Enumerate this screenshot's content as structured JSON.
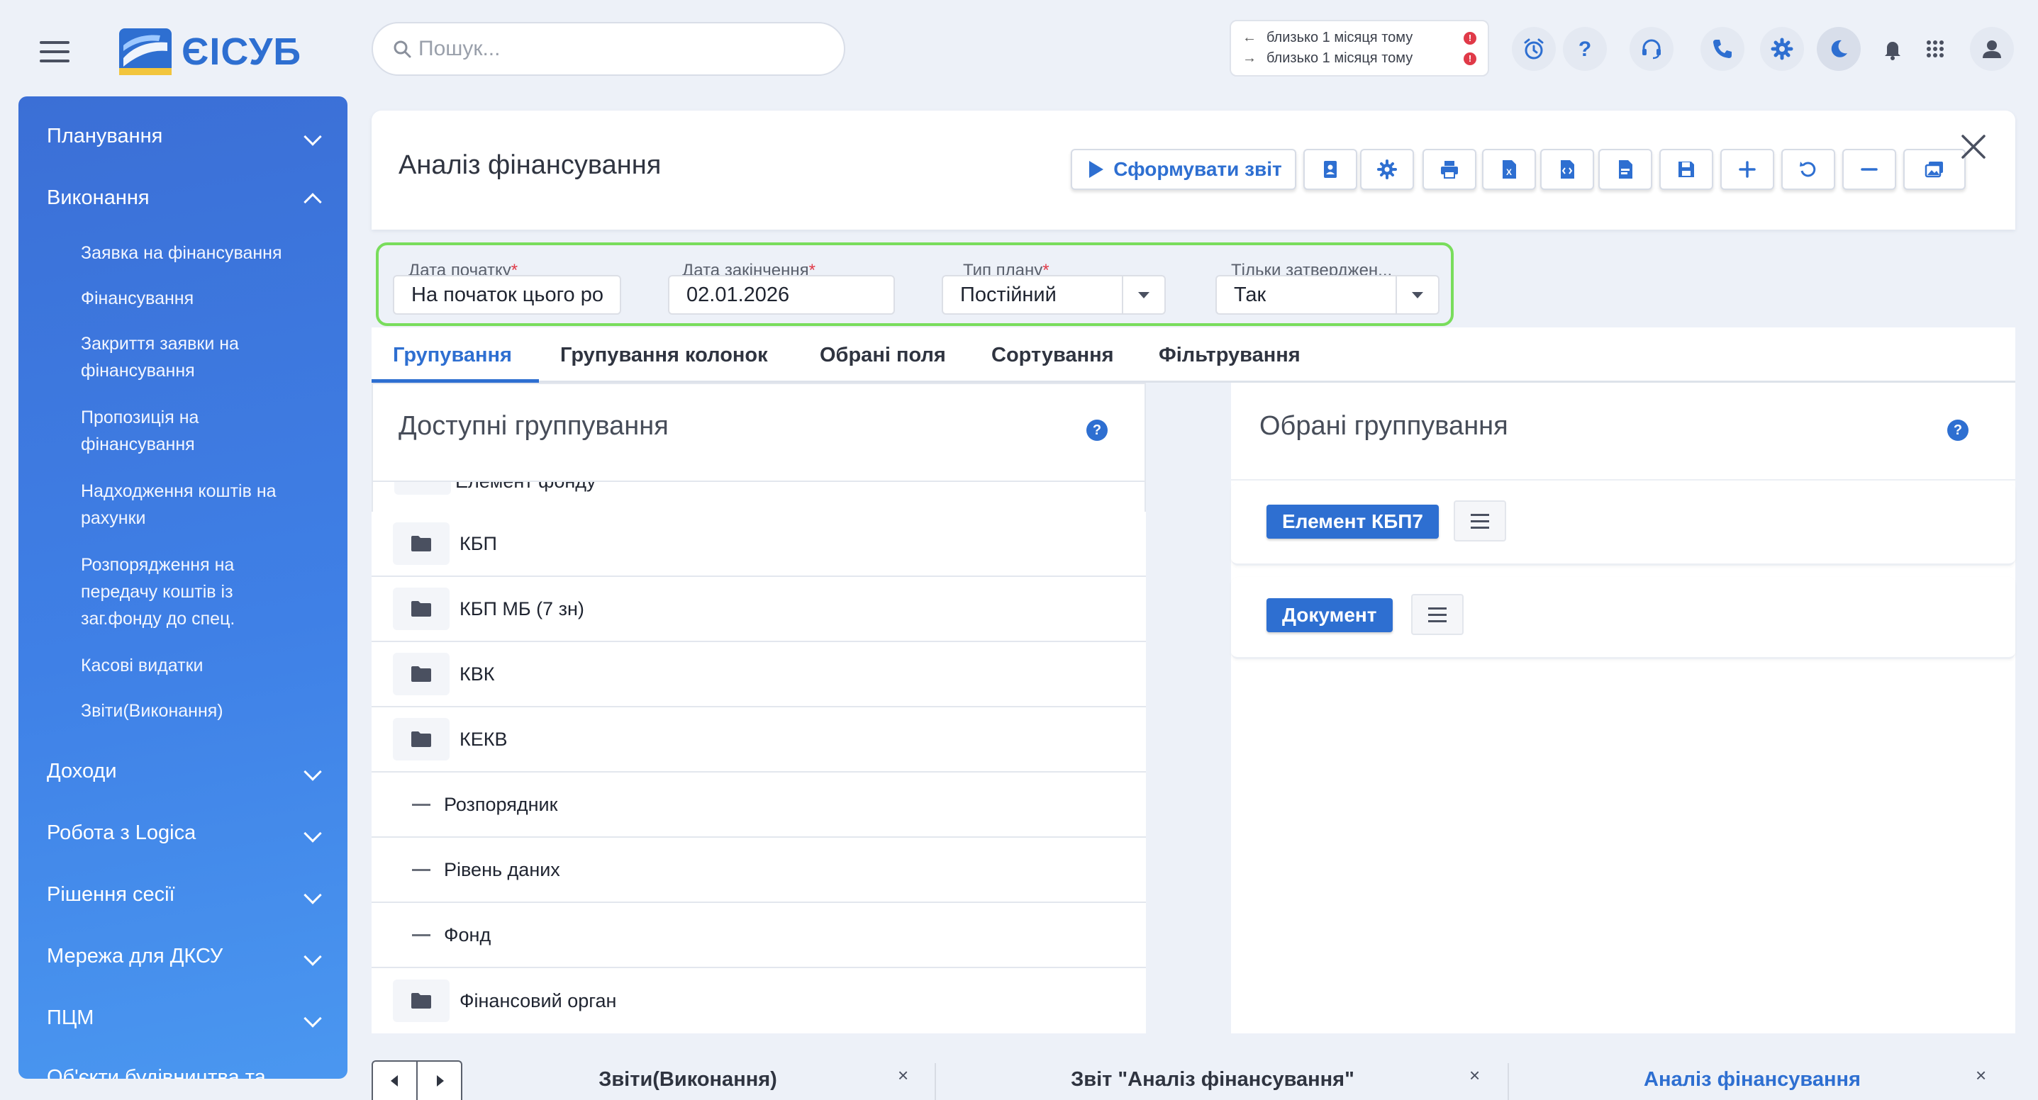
{
  "app": {
    "logo_text": "ЄІСУБ",
    "brand_color": "#2e6fd1"
  },
  "search": {
    "placeholder": "Пошук..."
  },
  "history": [
    {
      "arrow": "←",
      "text": "близько 1 місяця тому",
      "badge": "!"
    },
    {
      "arrow": "→",
      "text": "близько 1 місяця тому",
      "badge": "!"
    }
  ],
  "top_icons": [
    "alarm-icon",
    "help-icon",
    "support-headset-icon",
    "phone-icon",
    "settings-gear-icon",
    "dark-mode-moon-icon",
    "notifications-bell-icon",
    "apps-grid-icon",
    "user-avatar-icon"
  ],
  "sidebar": {
    "items": [
      {
        "label": "Планування",
        "expanded": false
      },
      {
        "label": "Виконання",
        "expanded": true
      },
      {
        "label": "Доходи",
        "expanded": false
      },
      {
        "label": "Робота з Logica",
        "expanded": false
      },
      {
        "label": "Рішення сесії",
        "expanded": false
      },
      {
        "label": "Мережа для ДКСУ",
        "expanded": false
      },
      {
        "label": "ПЦМ",
        "expanded": false
      },
      {
        "label": "Об'єкти будівництва та",
        "expanded": false
      }
    ],
    "sub_items": [
      {
        "line1": "Заявка на фінансування",
        "line2": "",
        "line3": ""
      },
      {
        "line1": "Фінансування",
        "line2": "",
        "line3": ""
      },
      {
        "line1": "Закриття заявки на",
        "line2": "фінансування",
        "line3": ""
      },
      {
        "line1": "Пропозиція на",
        "line2": "фінансування",
        "line3": ""
      },
      {
        "line1": "Надходження коштів на",
        "line2": "рахунки",
        "line3": ""
      },
      {
        "line1": "Розпорядження на",
        "line2": "передачу коштів із",
        "line3": "заг.фонду до спец."
      },
      {
        "line1": "Касові видатки",
        "line2": "",
        "line3": ""
      },
      {
        "line1": "Звіти(Виконання)",
        "line2": "",
        "line3": ""
      }
    ]
  },
  "report": {
    "title": "Аналіз фінансування",
    "generate_label": "Сформувати звіт",
    "toolbar_icons": [
      "report-card-icon",
      "settings-gear-icon",
      "print-icon",
      "excel-export-icon",
      "code-export-icon",
      "pdf-export-icon",
      "save-icon",
      "add-icon",
      "reset-icon",
      "remove-icon",
      "gallery-icon"
    ]
  },
  "params": {
    "start_date": {
      "label": "Дата початку",
      "required": "*",
      "value": "На початок цього ро"
    },
    "end_date": {
      "label": "Дата закінчення",
      "required": "*",
      "value": "02.01.2026"
    },
    "plan_type": {
      "label": "Тип плану",
      "required": "*",
      "value": "Постійний"
    },
    "approved_only": {
      "label": "Тільки затверджен...",
      "value": "Так"
    }
  },
  "tabs": [
    "Групування",
    "Групування колонок",
    "Обрані поля",
    "Сортування",
    "Фільтрування"
  ],
  "available": {
    "title": "Доступні группування",
    "help": "?",
    "partial_row": "Елемент фонду",
    "rows": [
      {
        "icon": "folder-icon",
        "label": "КБП"
      },
      {
        "icon": "folder-icon",
        "label": "КБП МБ (7 зн)"
      },
      {
        "icon": "folder-icon",
        "label": "КВК"
      },
      {
        "icon": "folder-icon",
        "label": "КЕКВ"
      },
      {
        "icon": "dash-icon",
        "label": "Розпорядник"
      },
      {
        "icon": "dash-icon",
        "label": "Рівень даних"
      },
      {
        "icon": "dash-icon",
        "label": "Фонд"
      },
      {
        "icon": "folder-icon",
        "label": "Фінансовий орган"
      }
    ]
  },
  "transfer": {
    "move_all_left": "«",
    "move_left": "‹",
    "move_right": "›",
    "move_down": "↴"
  },
  "selected": {
    "title": "Обрані группування",
    "help": "?",
    "items": [
      "Елемент КБП7",
      "Документ"
    ]
  },
  "bottom_tabs": [
    {
      "label": "Звіти(Виконання)",
      "close": "×"
    },
    {
      "label": "Звіт \"Аналіз фінансування\"",
      "close": "×"
    },
    {
      "label": "Аналіз фінансування",
      "close": "×"
    }
  ]
}
